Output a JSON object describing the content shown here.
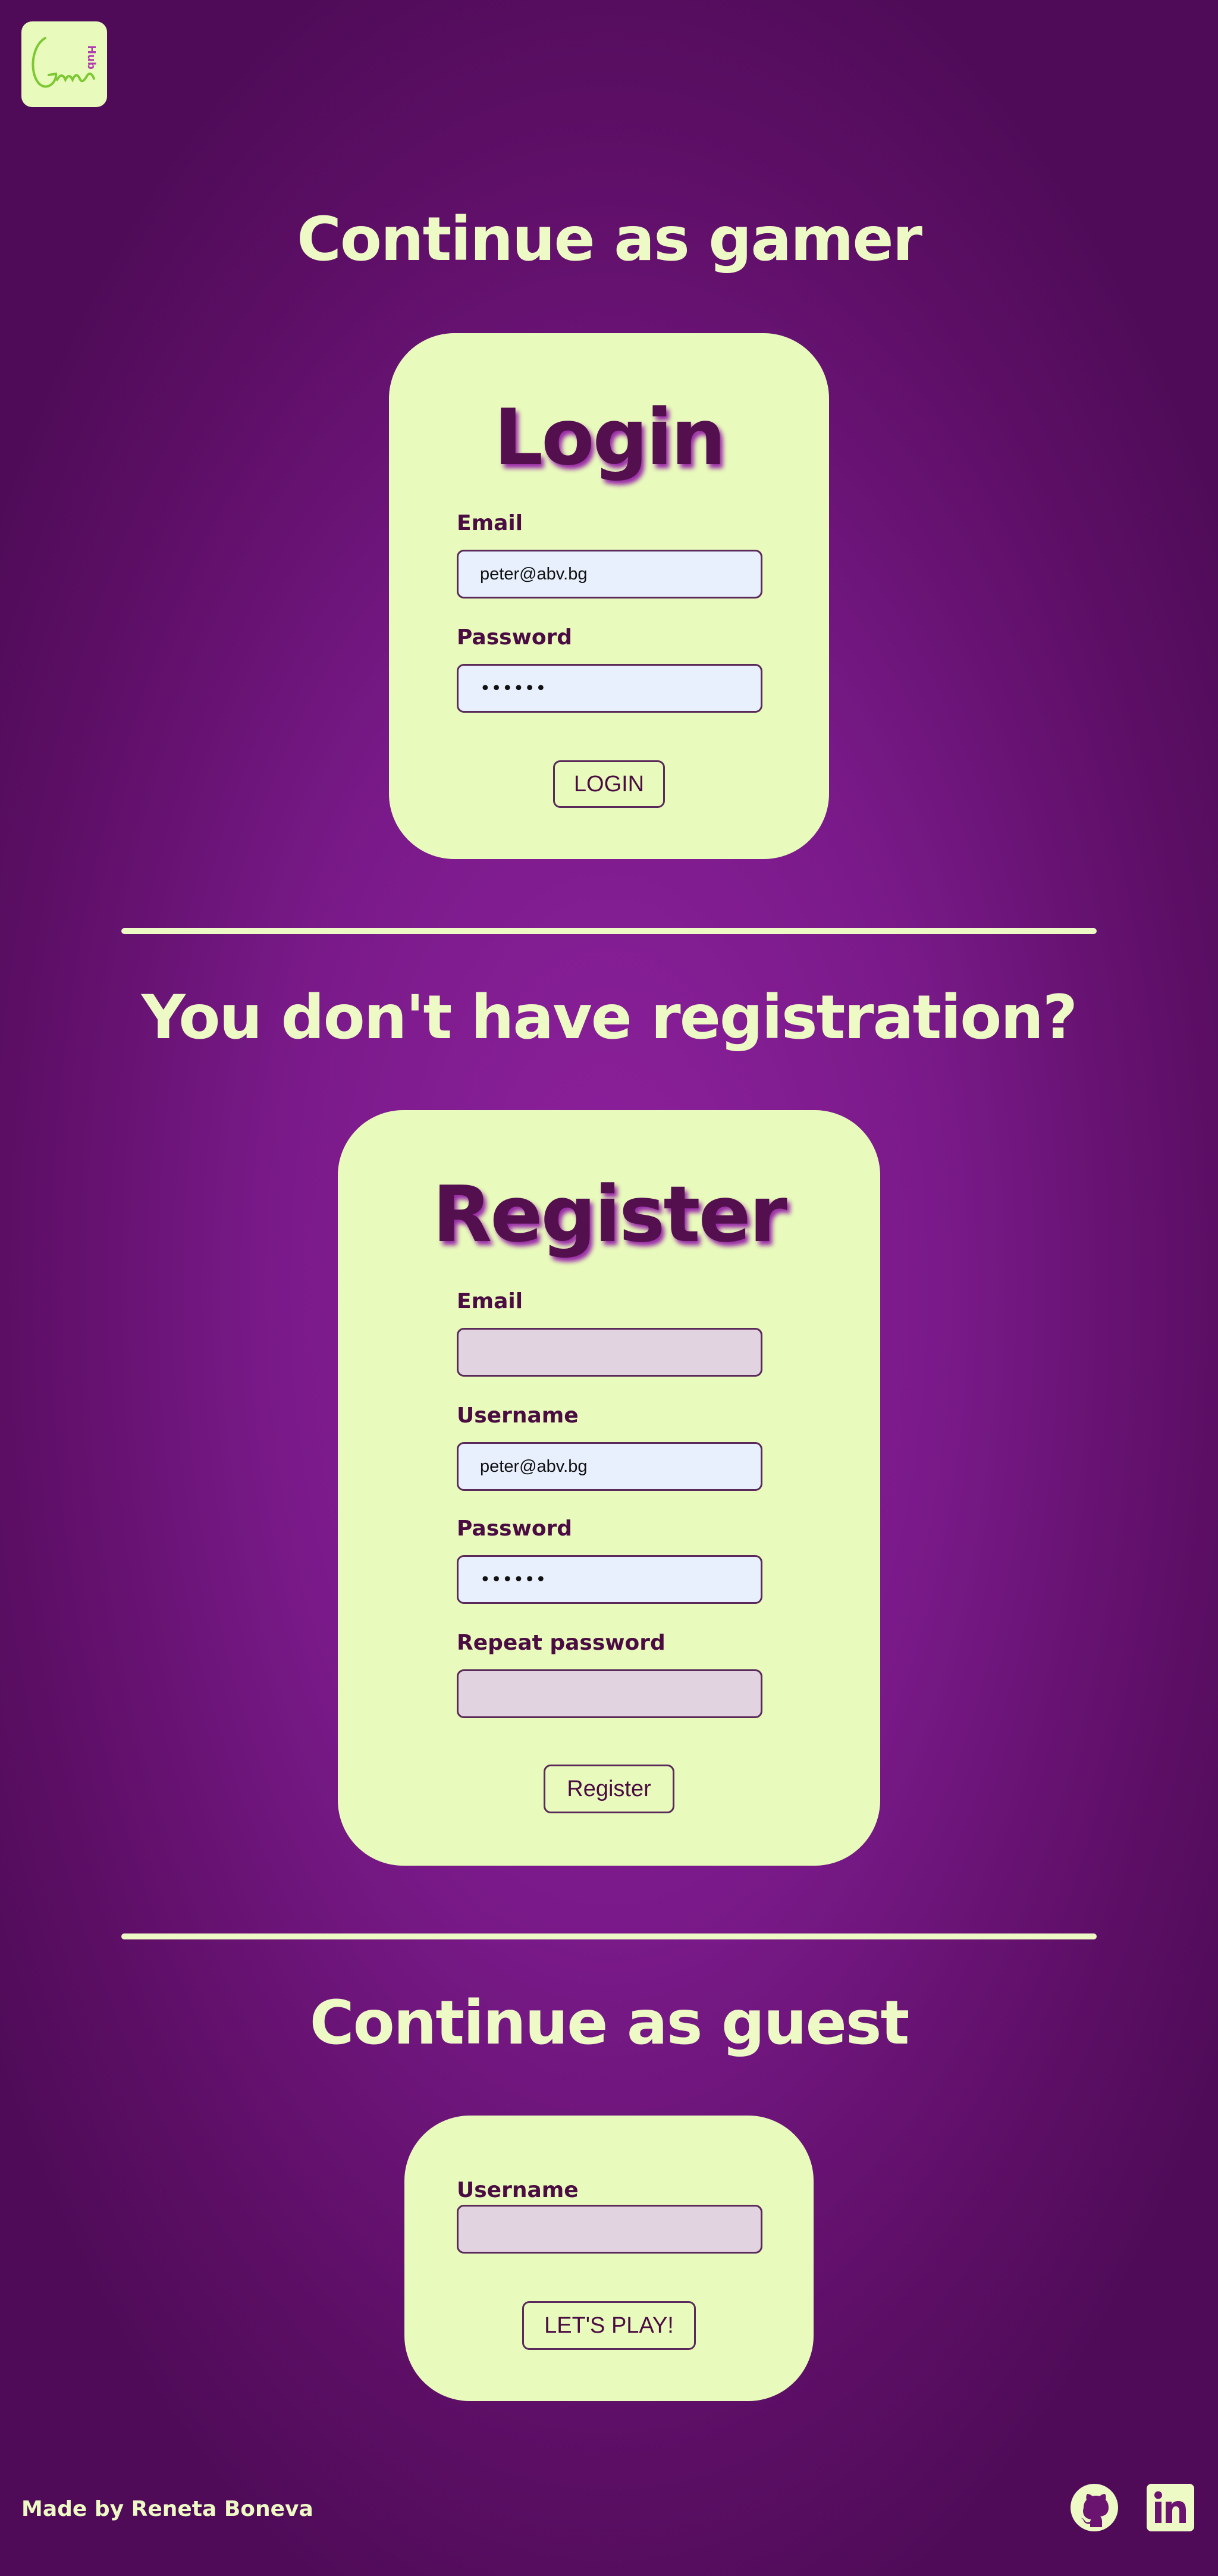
{
  "logo": {
    "text": "Game",
    "subtext": "Hub"
  },
  "gamer_section": {
    "title": "Continue as gamer",
    "login_card": {
      "title": "Login",
      "email_label": "Email",
      "email_value": "peter@abv.bg",
      "password_label": "Password",
      "password_value": "••••••",
      "button_label": "LOGIN"
    }
  },
  "register_section": {
    "title": "You don't have registration?",
    "register_card": {
      "title": "Register",
      "email_label": "Email",
      "email_value": "",
      "username_label": "Username",
      "username_value": "peter@abv.bg",
      "password_label": "Password",
      "password_value": "••••••",
      "repeat_password_label": "Repeat password",
      "repeat_password_value": "",
      "button_label": "Register"
    }
  },
  "guest_section": {
    "title": "Continue as guest",
    "guest_card": {
      "username_label": "Username",
      "username_value": "",
      "button_label": "LET'S PLAY!"
    }
  },
  "footer": {
    "credit": "Made by Reneta Boneva",
    "icons": [
      "github-icon",
      "linkedin-icon"
    ]
  },
  "colors": {
    "background": "#8e219d",
    "card": "#e8fbbc",
    "title_text": "#eefac5",
    "card_text": "#54104e",
    "filled_input": "#e8f0fe",
    "empty_input": "#e1d3e0"
  }
}
